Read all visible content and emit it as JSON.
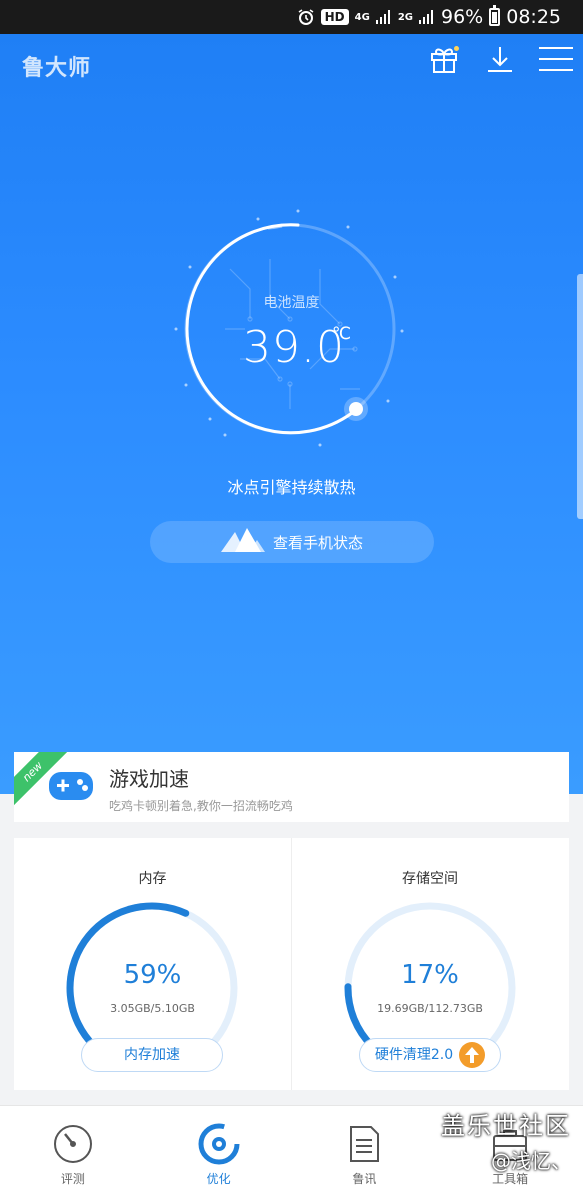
{
  "status_bar": {
    "hd": "HD",
    "net1": "4G",
    "net2": "2G",
    "battery": "96%",
    "time": "08:25"
  },
  "header": {
    "app_name": "鲁大师",
    "icons": [
      "gift-icon",
      "download-icon",
      "menu-icon"
    ]
  },
  "hero": {
    "gauge_label": "电池温度",
    "temperature": "39.0",
    "unit": "℃",
    "status": "冰点引擎持续散热",
    "check_button": "查看手机状态"
  },
  "game_card": {
    "badge": "new",
    "title": "游戏加速",
    "subtitle": "吃鸡卡顿别着急,教你一招流畅吃鸡"
  },
  "stats": {
    "memory": {
      "title": "内存",
      "percent": "59%",
      "percent_value": 59,
      "detail": "3.05GB/5.10GB",
      "button": "内存加速"
    },
    "storage": {
      "title": "存储空间",
      "percent": "17%",
      "percent_value": 17,
      "detail": "19.69GB/112.73GB",
      "button": "硬件清理2.0"
    }
  },
  "bottom_nav": {
    "items": [
      {
        "label": "评测",
        "icon": "speedometer-icon"
      },
      {
        "label": "优化",
        "icon": "optimize-icon",
        "active": true
      },
      {
        "label": "鲁讯",
        "icon": "news-icon"
      },
      {
        "label": "工具箱",
        "icon": "toolbox-icon"
      }
    ]
  },
  "watermark": {
    "line1": "盖乐世社区",
    "line2": "@浅忆、"
  },
  "colors": {
    "brand_blue": "#1f7fd8",
    "hero_blue": "#2c8cff",
    "accent_orange": "#f39c2a",
    "new_green": "#3dc26a"
  }
}
